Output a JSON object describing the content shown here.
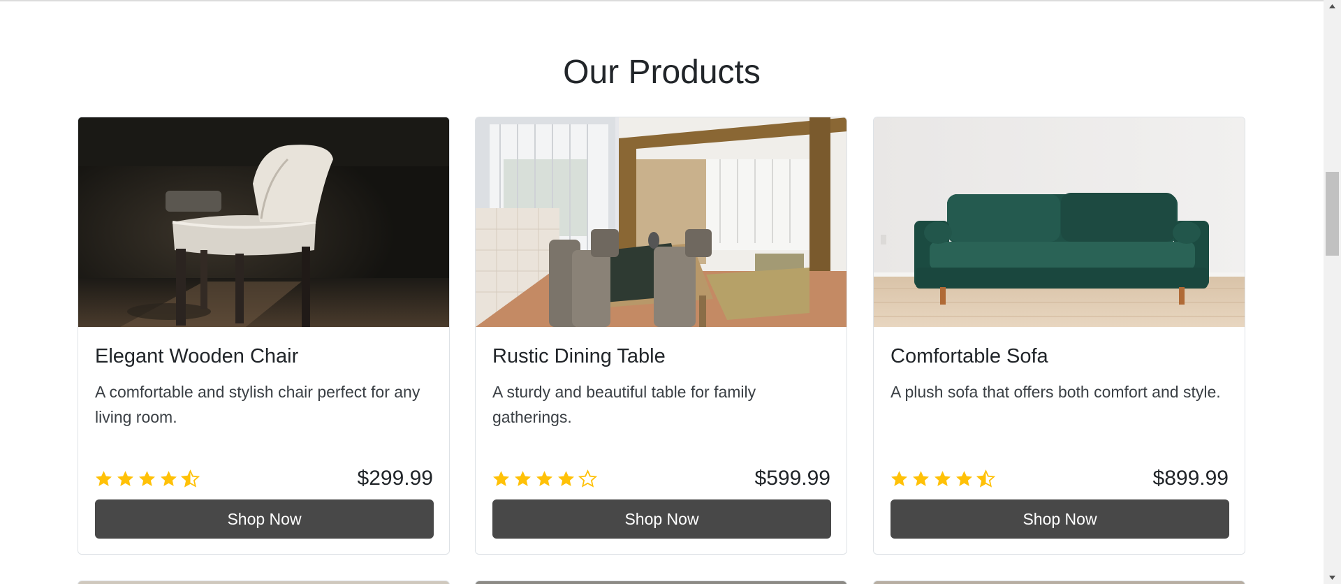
{
  "section": {
    "title": "Our Products"
  },
  "products": [
    {
      "name": "Elegant Wooden Chair",
      "description": "A comfortable and stylish chair perfect for any living room.",
      "rating": 4.5,
      "price": "$299.99",
      "button_label": "Shop Now",
      "image_icon": "chair-photo"
    },
    {
      "name": "Rustic Dining Table",
      "description": "A sturdy and beautiful table for family gatherings.",
      "rating": 4,
      "price": "$599.99",
      "button_label": "Shop Now",
      "image_icon": "dining-room-photo"
    },
    {
      "name": "Comfortable Sofa",
      "description": "A plush sofa that offers both comfort and style.",
      "rating": 4.5,
      "price": "$899.99",
      "button_label": "Shop Now",
      "image_icon": "sofa-photo"
    }
  ],
  "colors": {
    "star": "#ffc107",
    "button": "#484848",
    "border": "#dee2e6",
    "text": "#212529"
  }
}
